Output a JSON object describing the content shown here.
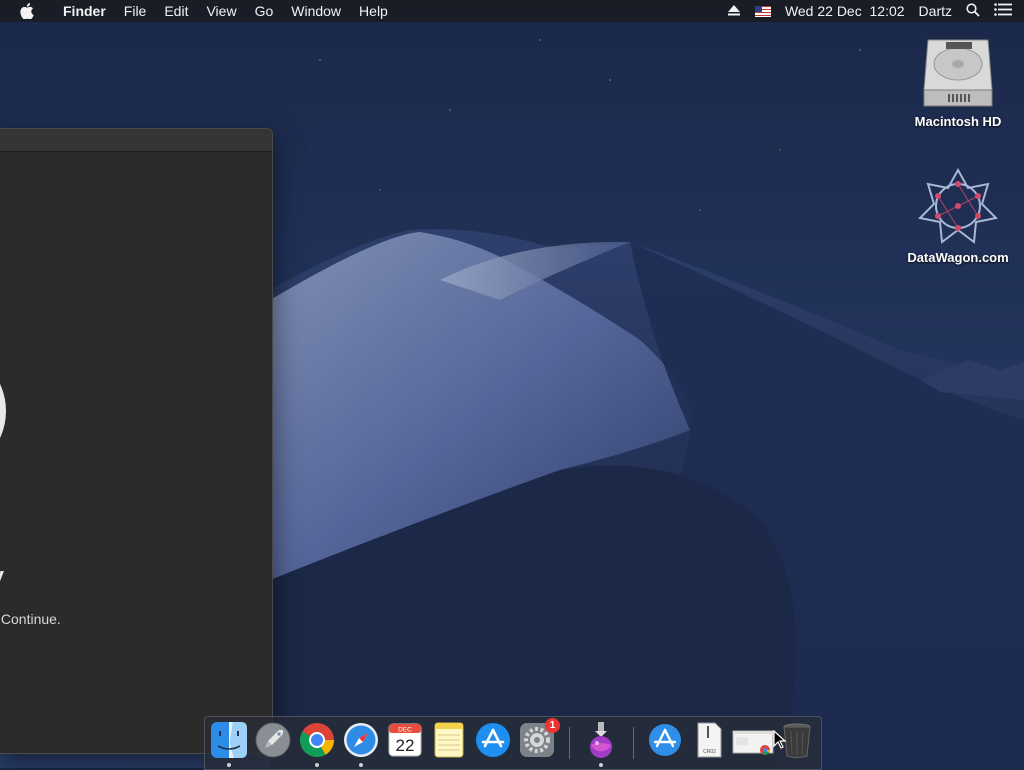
{
  "menubar": {
    "app_name": "Finder",
    "menus": [
      "File",
      "Edit",
      "View",
      "Go",
      "Window",
      "Help"
    ],
    "datetime": "Wed 22 Dec  12:02",
    "user": "Dartz"
  },
  "desktop": {
    "icons": [
      {
        "label": "Macintosh HD"
      },
      {
        "label": "DataWagon.com"
      }
    ]
  },
  "window": {
    "heading_fragment": "y",
    "subtext_fragment": "k Continue."
  },
  "dock": {
    "calendar_month": "DEC",
    "calendar_day": "22",
    "prefs_badge": "1",
    "dmg_label": "CR02"
  }
}
